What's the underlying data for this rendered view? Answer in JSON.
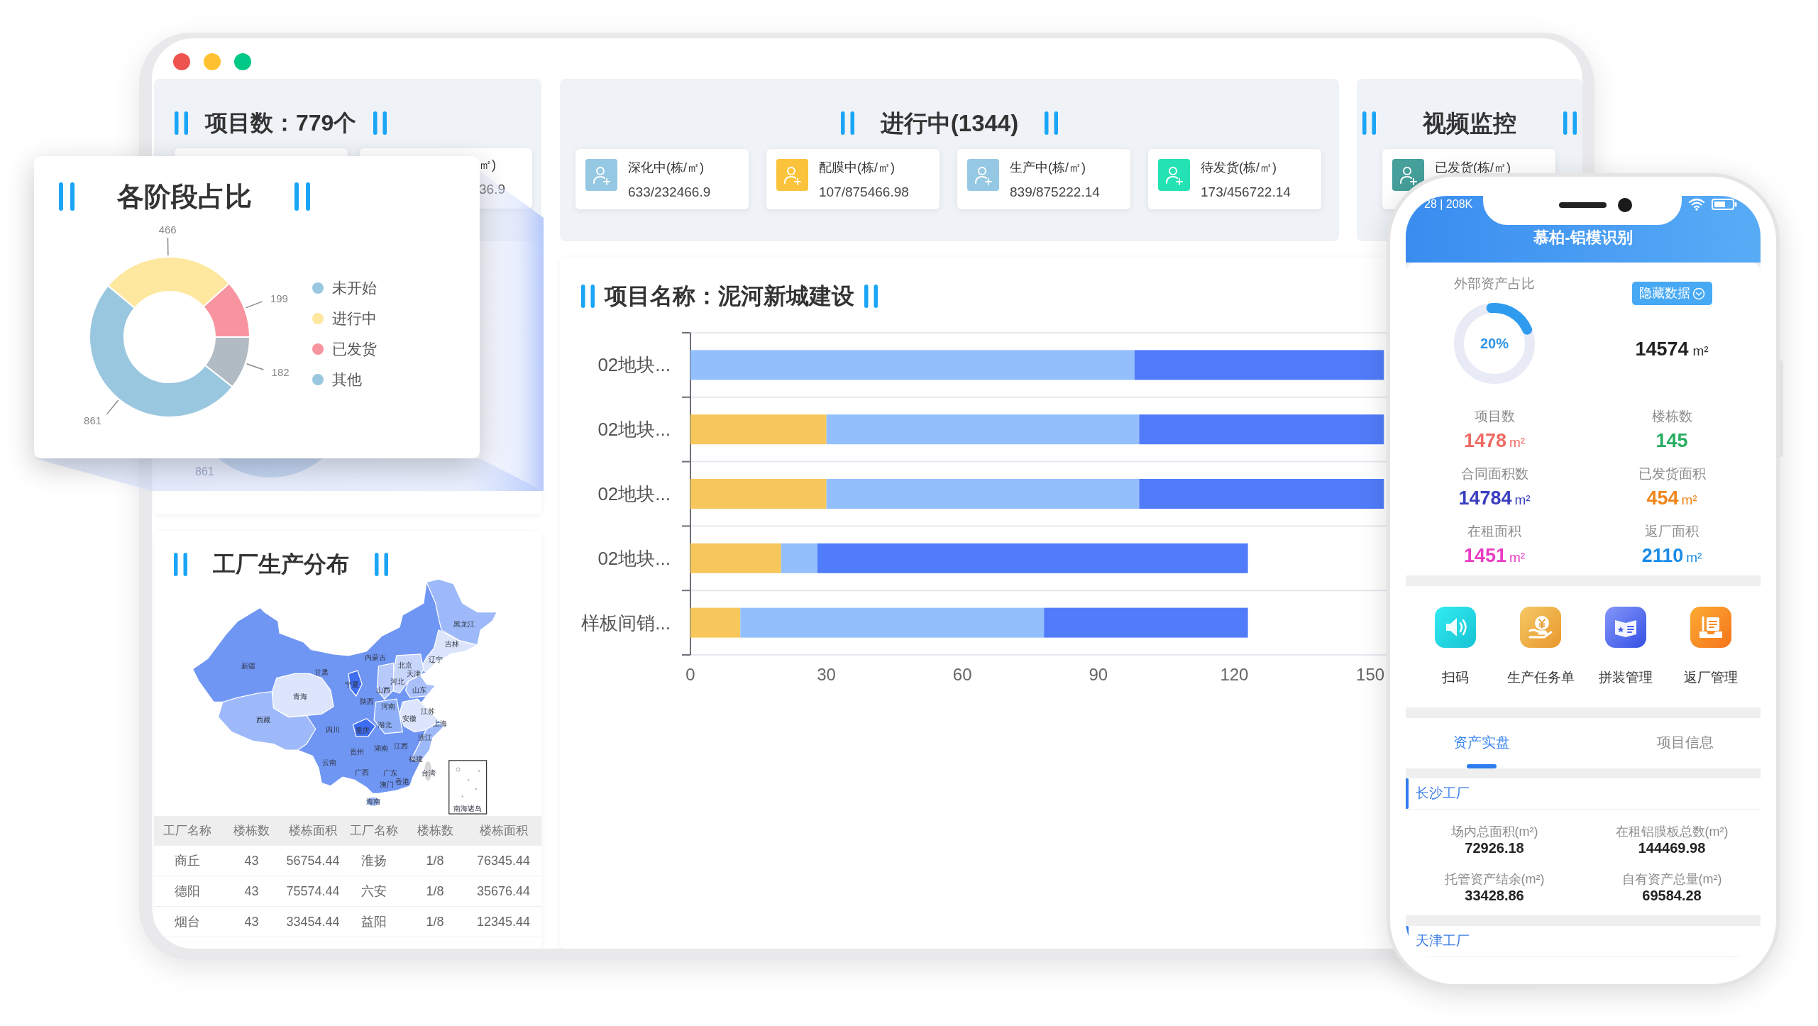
{
  "window": {
    "stats_panel": {
      "title": "项目数：779个",
      "partial_card": {
        "label": "㎡)",
        "value": "36.9"
      }
    },
    "progress_panel": {
      "title": "进行中(1344)",
      "cards": [
        {
          "label": "深化中(栋/㎡)",
          "value": "633/232466.9",
          "color": "#95c8e2"
        },
        {
          "label": "配膜中(栋/㎡)",
          "value": "107/875466.98",
          "color": "#fbc33b"
        },
        {
          "label": "生产中(栋/㎡)",
          "value": "839/875222.14",
          "color": "#95c8e2"
        },
        {
          "label": "待发货(栋/㎡)",
          "value": "173/456722.14",
          "color": "#25e2b4"
        }
      ]
    },
    "video_panel": {
      "title": "视频监控",
      "cards": [
        {
          "label": "已发货(栋/㎡)",
          "color": "#46a09b"
        }
      ]
    },
    "stage_panel": {
      "data_label": "861"
    },
    "project_panel": {
      "title": "项目名称：泥河新城建设",
      "chart_data": {
        "type": "bar",
        "orientation": "horizontal",
        "stacked": true,
        "categories": [
          "02地块...",
          "02地块...",
          "02地块...",
          "02地块...",
          "样板间销..."
        ],
        "series": [
          {
            "color": "#f8c75b",
            "values": [
              0,
              30,
              30,
              20,
              11
            ]
          },
          {
            "color": "#94bffd",
            "values": [
              98,
              69,
              69,
              8,
              67
            ]
          },
          {
            "color": "#507cf9",
            "values": [
              55,
              54,
              54,
              95,
              45
            ]
          }
        ],
        "xlim": [
          0,
          155
        ],
        "xticks": [
          0,
          30,
          60,
          90,
          120,
          150
        ]
      }
    },
    "factory_panel": {
      "title": "工厂生产分布",
      "map_labels": [
        "新疆",
        "西藏",
        "青海",
        "甘肃",
        "内蒙古",
        "黑龙江",
        "吉林",
        "辽宁",
        "北京",
        "天津",
        "河北",
        "山西",
        "山东",
        "宁夏",
        "陕西",
        "河南",
        "江苏",
        "安徽",
        "上海",
        "湖北",
        "四川",
        "重庆",
        "浙江",
        "贵州",
        "湖南",
        "江西",
        "福建",
        "云南",
        "广西",
        "广东",
        "台湾",
        "香港",
        "澳门",
        "海南"
      ],
      "inset_label": "南海诸岛",
      "table": {
        "columns": [
          "工厂名称",
          "楼栋数",
          "楼栋面积",
          "工厂名称",
          "楼栋数",
          "楼栋面积"
        ],
        "rows": [
          [
            "商丘",
            "43",
            "56754.44",
            "淮扬",
            "1/8",
            "76345.44"
          ],
          [
            "德阳",
            "43",
            "75574.44",
            "六安",
            "1/8",
            "35676.44"
          ],
          [
            "烟台",
            "43",
            "33454.44",
            "益阳",
            "1/8",
            "12345.44"
          ]
        ]
      }
    }
  },
  "stage_popup": {
    "title": "各阶段占比",
    "chart_data": {
      "type": "donut",
      "categories": [
        "未开始",
        "进行中",
        "已发货",
        "其他"
      ],
      "values": [
        861,
        466,
        199,
        182
      ],
      "colors": [
        "#9ac7e0",
        "#fee79e",
        "#f8949f",
        "#b0bbc4"
      ],
      "data_labels": true
    },
    "legend": [
      {
        "color": "#9ac7e0"
      },
      {
        "color": "#fee79e"
      },
      {
        "color": "#f8949f"
      },
      {
        "color": "#9ac7e0"
      }
    ]
  },
  "phone": {
    "status_text": "28 | 208K",
    "title": "慕柏-铝模识别",
    "summary": {
      "label": "外部资产占比",
      "level": 0.2,
      "percent": "20%",
      "button": "隐藏数据",
      "total": "14574",
      "unit": "m²"
    },
    "stats": [
      {
        "label": "项目数",
        "value": "1478",
        "unit": "m²",
        "color": "#ee6b64"
      },
      {
        "label": "楼栋数",
        "value": "145",
        "color": "#27ad60"
      },
      {
        "label": "合同面积数",
        "value": "14784",
        "unit": "m²",
        "color": "#3b3fc0"
      },
      {
        "label": "已发货面积",
        "value": "454",
        "unit": "m²",
        "color": "#f08518"
      },
      {
        "label": "在租面积",
        "value": "1451",
        "unit": "m²",
        "color": "#e93cc4"
      },
      {
        "label": "返厂面积",
        "value": "2110",
        "unit": "m²",
        "color": "#1b8be6"
      }
    ],
    "actions": [
      {
        "label": "扫码",
        "kind": "speaker"
      },
      {
        "label": "生产任务单",
        "kind": "coin"
      },
      {
        "label": "拼装管理",
        "kind": "book"
      },
      {
        "label": "返厂管理",
        "kind": "tray"
      }
    ],
    "tabs": [
      {
        "label": "资产实盘",
        "selected": true
      },
      {
        "label": "项目信息",
        "selected": false
      }
    ],
    "factories": [
      {
        "name": "长沙工厂",
        "metrics": [
          {
            "label": "场内总面积(m²)",
            "value": "72926.18"
          },
          {
            "label": "在租铝膜板总数(m²)",
            "value": "144469.98"
          },
          {
            "label": "托管资产结余(m²)",
            "value": "33428.86"
          },
          {
            "label": "自有资产总量(m²)",
            "value": "69584.28"
          }
        ]
      },
      {
        "name": "天津工厂"
      }
    ]
  }
}
